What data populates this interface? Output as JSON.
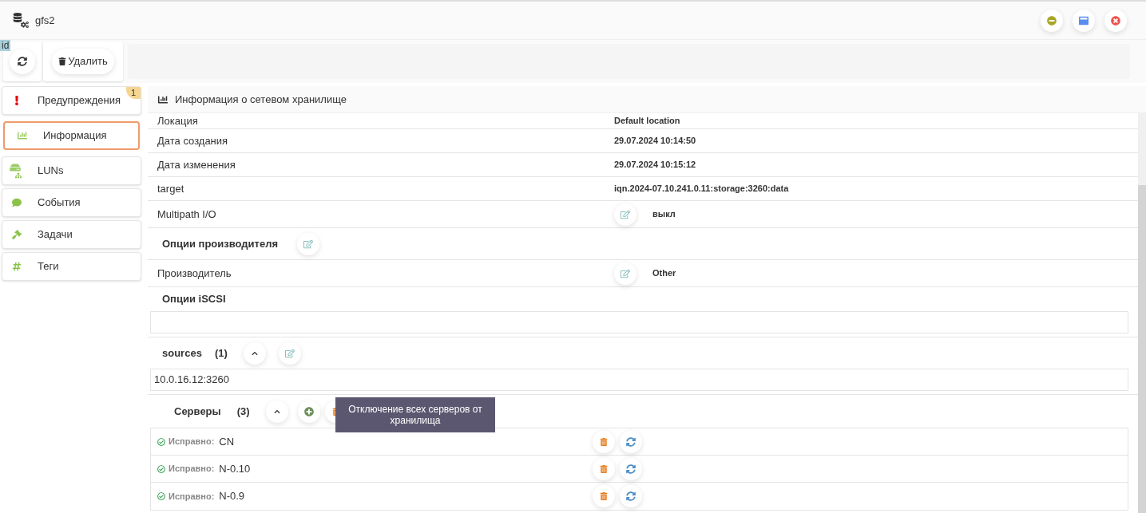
{
  "window": {
    "title": "gfs2"
  },
  "id_badge": "id",
  "toolbar": {
    "delete_label": "Удалить"
  },
  "sidebar": {
    "items": [
      {
        "label": "Предупреждения",
        "badge": "1",
        "selected": false
      },
      {
        "label": "Информация",
        "selected": true
      },
      {
        "label": "LUNs",
        "selected": false
      },
      {
        "label": "События",
        "selected": false
      },
      {
        "label": "Задачи",
        "selected": false
      },
      {
        "label": "Теги",
        "selected": false
      }
    ]
  },
  "panel": {
    "title": "Информация о сетевом хранилище",
    "rows": [
      {
        "kind": "field",
        "label": "Локация",
        "value": "Default location"
      },
      {
        "kind": "field",
        "label": "Дата создания",
        "value": "29.07.2024 10:14:50"
      },
      {
        "kind": "field",
        "label": "Дата изменения",
        "value": "29.07.2024 10:15:12"
      },
      {
        "kind": "field",
        "label": "target",
        "value": "iqn.2024-07.10.241.0.11:storage:3260:data"
      },
      {
        "kind": "editable",
        "label": "Multipath I/O",
        "value": "выкл"
      },
      {
        "kind": "section",
        "label": "Опции производителя"
      },
      {
        "kind": "editable",
        "label": "Производитель",
        "value": "Other"
      }
    ],
    "iscsi": {
      "title": "Опции iSCSI"
    },
    "sources": {
      "title": "sources",
      "count": "(1)",
      "expanded": true,
      "items": [
        "10.0.16.12:3260"
      ]
    },
    "servers": {
      "title": "Серверы",
      "count": "(3)",
      "expanded": true,
      "tooltip": "Отключение всех серверов от хранилища",
      "items": [
        {
          "status": "Исправно:",
          "name": "CN",
          "healthy": true
        },
        {
          "status": "Исправно:",
          "name": "N-0.10",
          "healthy": true
        },
        {
          "status": "Исправно:",
          "name": "N-0.9",
          "healthy": true
        }
      ]
    }
  }
}
